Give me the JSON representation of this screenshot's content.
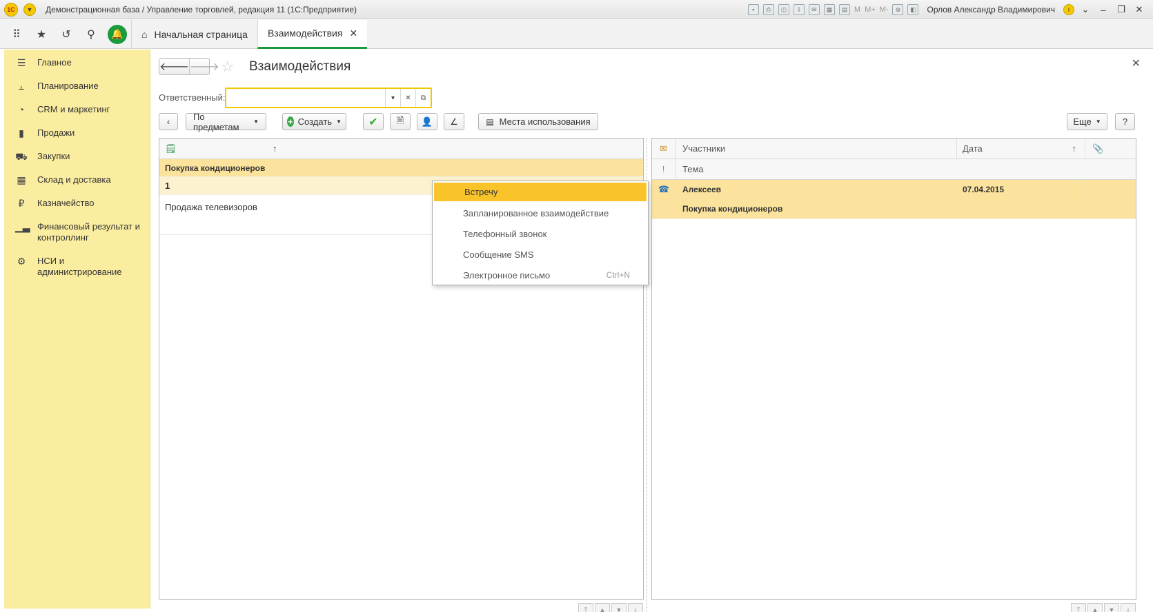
{
  "window": {
    "title": "Демонстрационная база / Управление торговлей, редакция 11  (1С:Предприятие)",
    "user": "Орлов Александр Владимирович",
    "tool_texts": [
      "M",
      "M+",
      "M-"
    ]
  },
  "tabs": {
    "home": "Начальная страница",
    "active": "Взаимодействия"
  },
  "sidebar": {
    "items": [
      {
        "label": "Главное",
        "icon": "menu-lines-icon"
      },
      {
        "label": "Планирование",
        "icon": "planning-icon"
      },
      {
        "label": "CRM и маркетинг",
        "icon": "pie-chart-icon"
      },
      {
        "label": "Продажи",
        "icon": "bag-icon"
      },
      {
        "label": "Закупки",
        "icon": "cart-icon"
      },
      {
        "label": "Склад и доставка",
        "icon": "warehouse-icon"
      },
      {
        "label": "Казначейство",
        "icon": "ruble-icon"
      },
      {
        "label": "Финансовый результат и контроллинг",
        "icon": "bar-chart-icon"
      },
      {
        "label": "НСИ и администрирование",
        "icon": "gear-icon"
      }
    ]
  },
  "form": {
    "title": "Взаимодействия",
    "responsible_label": "Ответственный:",
    "responsible_value": ""
  },
  "toolbar": {
    "by_subjects": "По предметам",
    "create": "Создать",
    "usage_places": "Места использования",
    "more": "Еще",
    "help": "?"
  },
  "left_list": {
    "rows": [
      {
        "text": "Покупка кондиционеров"
      },
      {
        "text": "1"
      },
      {
        "text": "Продажа телевизоров"
      }
    ]
  },
  "right_list": {
    "columns": {
      "participants": "Участники",
      "date": "Дата",
      "theme": "Тема"
    },
    "rows": [
      {
        "participants": "Алексеев",
        "date": "07.04.2015",
        "theme": "Покупка кондиционеров"
      }
    ]
  },
  "create_menu": {
    "items": [
      {
        "label": "Встречу",
        "shortcut": ""
      },
      {
        "label": "Запланированное взаимодействие",
        "shortcut": ""
      },
      {
        "label": "Телефонный звонок",
        "shortcut": ""
      },
      {
        "label": "Сообщение SMS",
        "shortcut": ""
      },
      {
        "label": "Электронное письмо",
        "shortcut": "Ctrl+N"
      }
    ]
  },
  "colors": {
    "accent": "#1a9b3c",
    "sidebar": "#fbeda0",
    "selection": "#fbe39e",
    "highlight": "#f9c42a"
  }
}
